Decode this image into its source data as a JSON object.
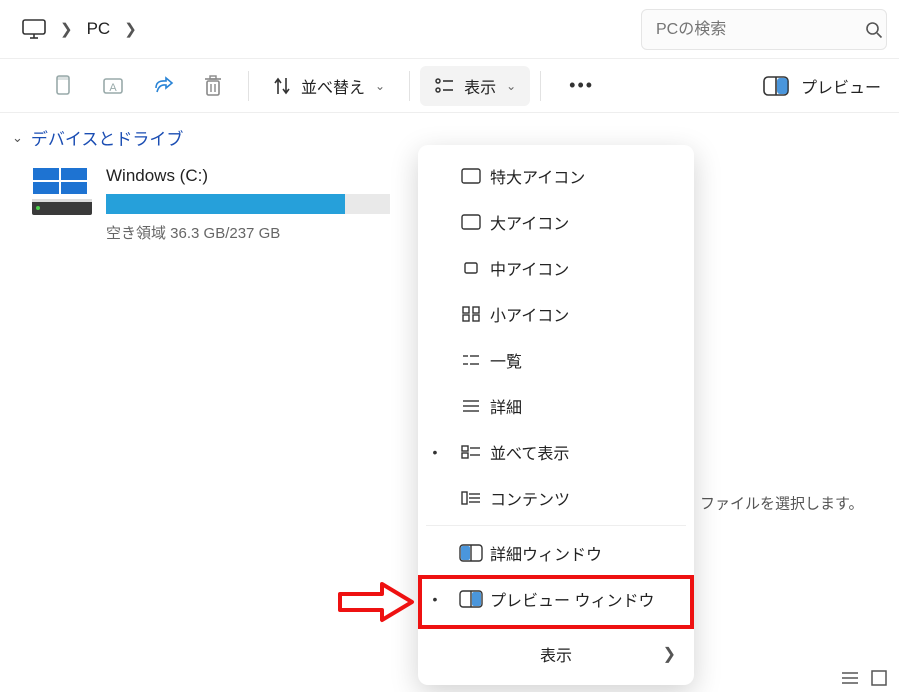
{
  "breadcrumb": {
    "location": "PC"
  },
  "search": {
    "placeholder": "PCの検索"
  },
  "toolbar": {
    "sort_label": "並べ替え",
    "view_label": "表示",
    "preview_label": "プレビュー"
  },
  "sidebar": {
    "section_label": "デバイスとドライブ",
    "drive": {
      "name": "Windows (C:)",
      "free_text": "空き領域 36.3 GB/237 GB",
      "used_percent": 84
    }
  },
  "right_pane": {
    "hint": "ファイルを選択します。"
  },
  "view_menu": {
    "items": [
      {
        "label": "特大アイコン",
        "icon": "rect",
        "bullet": false
      },
      {
        "label": "大アイコン",
        "icon": "rect",
        "bullet": false
      },
      {
        "label": "中アイコン",
        "icon": "rect-sm",
        "bullet": false
      },
      {
        "label": "小アイコン",
        "icon": "grid4",
        "bullet": false
      },
      {
        "label": "一覧",
        "icon": "list2",
        "bullet": false
      },
      {
        "label": "詳細",
        "icon": "list3",
        "bullet": false
      },
      {
        "label": "並べて表示",
        "icon": "tiles",
        "bullet": true
      },
      {
        "label": "コンテンツ",
        "icon": "content",
        "bullet": false
      }
    ],
    "pane_items": [
      {
        "label": "詳細ウィンドウ",
        "icon": "details-pane",
        "bullet": false
      },
      {
        "label": "プレビュー ウィンドウ",
        "icon": "preview-pane",
        "bullet": true
      }
    ],
    "footer_label": "表示"
  }
}
